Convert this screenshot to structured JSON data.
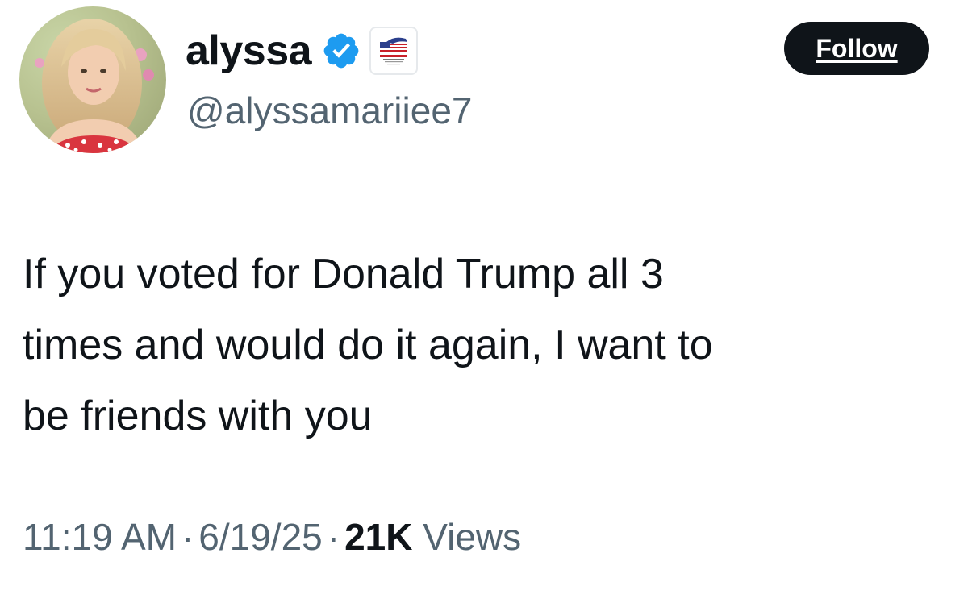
{
  "author": {
    "display_name": "alyssa",
    "handle": "@alyssamariiee7",
    "verified": true,
    "verified_icon": "verified-checkmark-icon",
    "affiliate_badge_icon": "eagle-flag-affiliate-icon"
  },
  "actions": {
    "follow_label": "Follow"
  },
  "tweet": {
    "lines": [
      "If you voted for Donald Trump all 3",
      "times and would do it again, I want to",
      "be friends with you"
    ]
  },
  "meta": {
    "time": "11:19 AM",
    "separator": "·",
    "date": "6/19/25",
    "views_count": "21K",
    "views_label": "Views"
  },
  "colors": {
    "text_primary": "#0f1419",
    "text_secondary": "#536471",
    "verified_blue": "#1d9bf0",
    "follow_button_bg": "#0f1419"
  }
}
